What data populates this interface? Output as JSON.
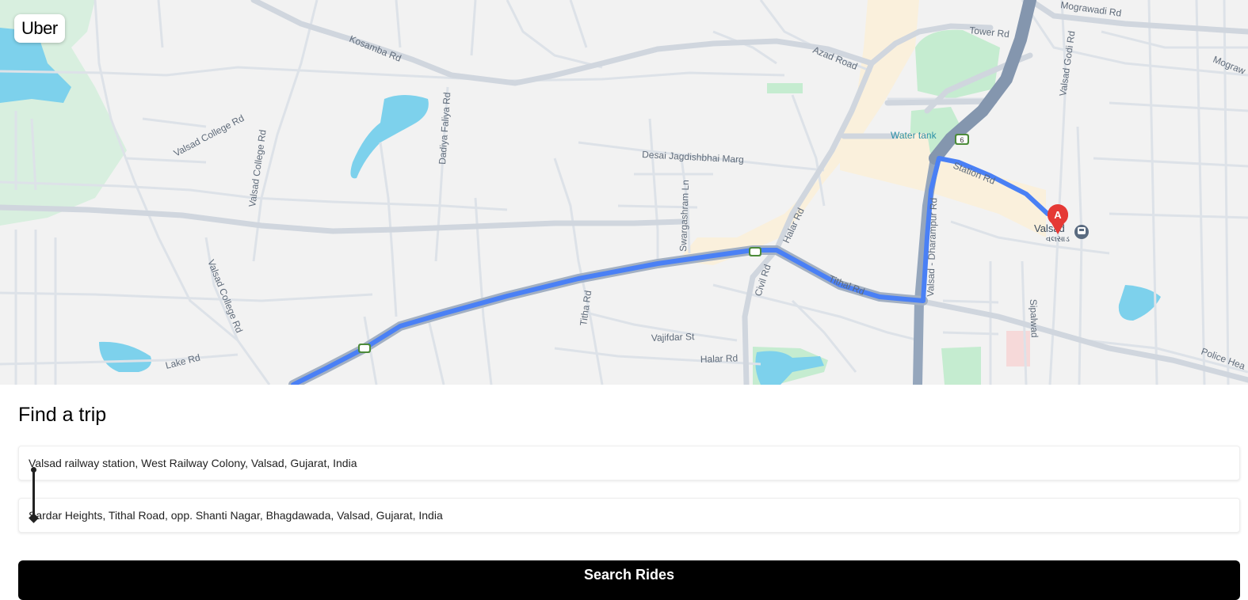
{
  "app": {
    "logo": "Uber"
  },
  "map": {
    "route_color": "#4a80f5",
    "streets": {
      "kosamba": "Kosamba Rd",
      "valsad_college_1": "Valsad College Rd",
      "valsad_college_2": "Valsad College Rd",
      "valsad_college_3": "Valsad College Rd",
      "dadiya_faliya": "Dadiya Faliya Rd",
      "desai": "Desai Jagdishbhai Marg",
      "swargashram": "Swargashram Ln",
      "halar": "Halar Rd",
      "civil": "Civil Rd",
      "tithal": "Tithal Rd",
      "tithal2": "Titha Rd",
      "vajifdar": "Vajifdar St",
      "halar2": "Halar Rd",
      "lake": "Lake Rd",
      "azad": "Azad Road",
      "tower": "Tower Rd",
      "station": "Station Rd",
      "dharampur": "Valsad - Dharampur Rd",
      "godi": "Valsad Godi Rd",
      "mograwadi": "Mograwadi Rd",
      "mograw2": "Mograw",
      "police": "Police Hea",
      "sipalwad": "Sipalwad"
    },
    "places": {
      "water_tank": "Water tank",
      "valsad": "Valsad",
      "valsad_gujarati": "વલસાડ"
    },
    "highway_shield": "6",
    "marker_label": "A"
  },
  "trip": {
    "title": "Find a trip",
    "pickup": "Valsad railway station, West Railway Colony, Valsad, Gujarat, India",
    "dropoff": "Sardar Heights, Tithal Road, opp. Shanti Nagar, Bhagdawada, Valsad, Gujarat, India",
    "search_button": "Search Rides"
  }
}
